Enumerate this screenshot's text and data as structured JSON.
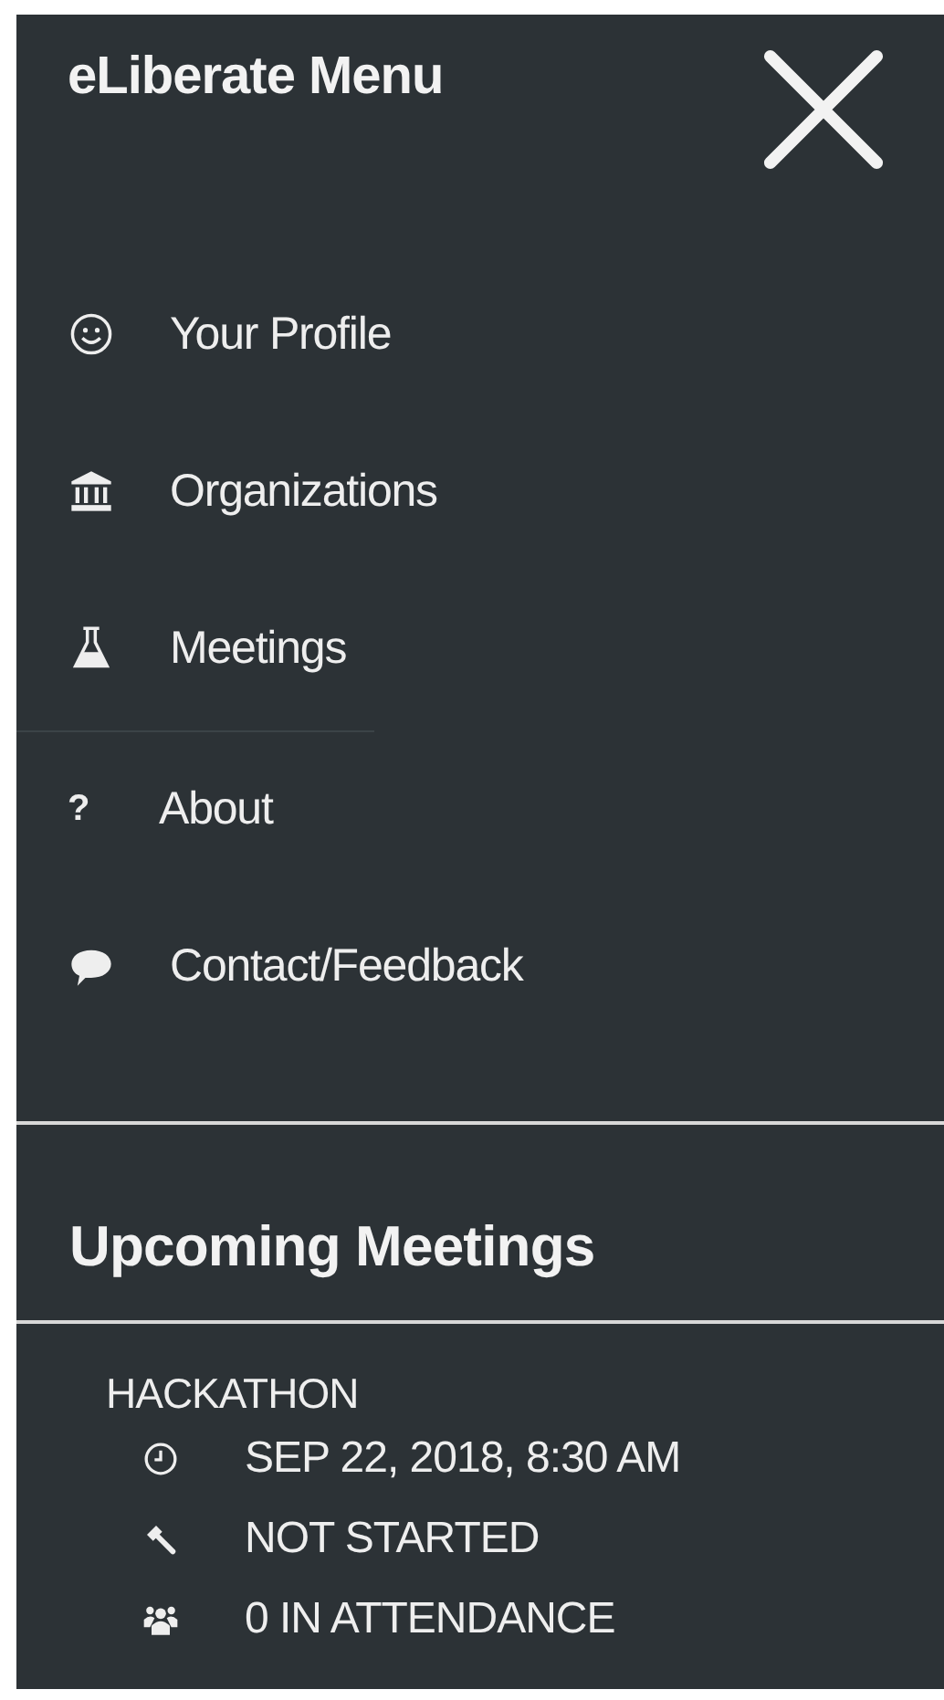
{
  "menu": {
    "title": "eLiberate Menu"
  },
  "items": [
    {
      "kind": "profile",
      "label": "Your Profile"
    },
    {
      "kind": "organizations",
      "label": "Organizations"
    },
    {
      "kind": "meetings",
      "label": "Meetings"
    },
    {
      "kind": "about",
      "glyph": "?",
      "label": "About"
    },
    {
      "kind": "contact",
      "label": "Contact/Feedback"
    }
  ],
  "upcoming": {
    "heading": "Upcoming Meetings",
    "meetings": [
      {
        "name": "HACKATHON",
        "details": [
          {
            "kind": "time",
            "text": "SEP 22, 2018, 8:30 AM"
          },
          {
            "kind": "status",
            "text": "NOT STARTED"
          },
          {
            "kind": "attendance",
            "text": "0 IN ATTENDANCE"
          }
        ]
      }
    ]
  }
}
